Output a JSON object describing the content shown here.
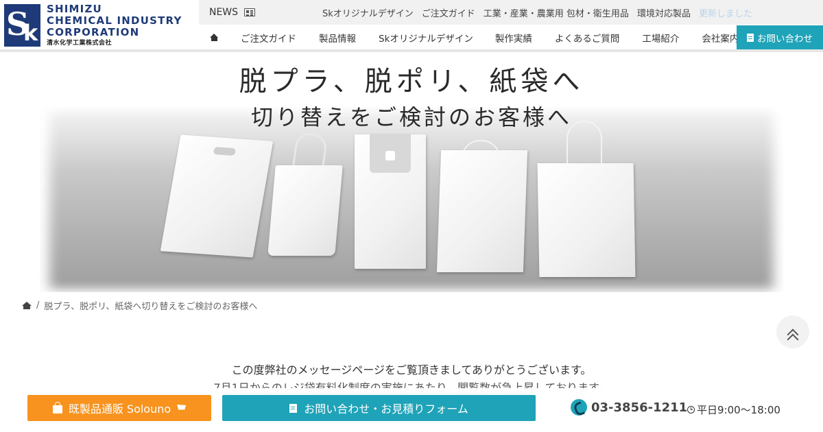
{
  "logo": {
    "line1": "SHIMIZU",
    "line2": "CHEMICAL INDUSTRY",
    "line3": "CORPORATION",
    "japanese": "清水化学工業株式会社",
    "mark": "Sk"
  },
  "news_tab": {
    "label": "NEWS",
    "icon": "newspaper-icon"
  },
  "top_links": [
    "Skオリジナルデザイン",
    "ご注文ガイド",
    "工業・産業・農業用 包材・衛生用品",
    "環境対応製品",
    "更新しました"
  ],
  "main_nav": {
    "home_icon": "home-icon",
    "items": [
      "ご注文ガイド",
      "製品情報",
      "Skオリジナルデザイン",
      "製作実績",
      "よくあるご質問",
      "工場紹介",
      "会社案内"
    ],
    "contact_label": "お問い合わせ"
  },
  "hero": {
    "title": "脱プラ、脱ポリ、紙袋へ",
    "subtitle": "切り替えをご検討のお客様へ"
  },
  "breadcrumb": {
    "current": "脱プラ、脱ポリ、紙袋へ切り替えをご検討のお客様へ",
    "separator": "/"
  },
  "message": {
    "line1": "この度弊社のメッセージページをご覧頂きましてありがとうございます。",
    "line2": "7月1日からのレジ袋有料化制度の実施にあたり、閲覧数が急上昇しております。"
  },
  "bottom_bar": {
    "shop_label": "既製品通販 Solouno",
    "form_label": "お問い合わせ・お見積りフォーム",
    "phone": "03-3856-1211",
    "hours": "平日9:00～18:00"
  },
  "colors": {
    "brand_navy": "#1f3a78",
    "accent_teal": "#1fa3b8",
    "accent_orange": "#f7931e"
  }
}
